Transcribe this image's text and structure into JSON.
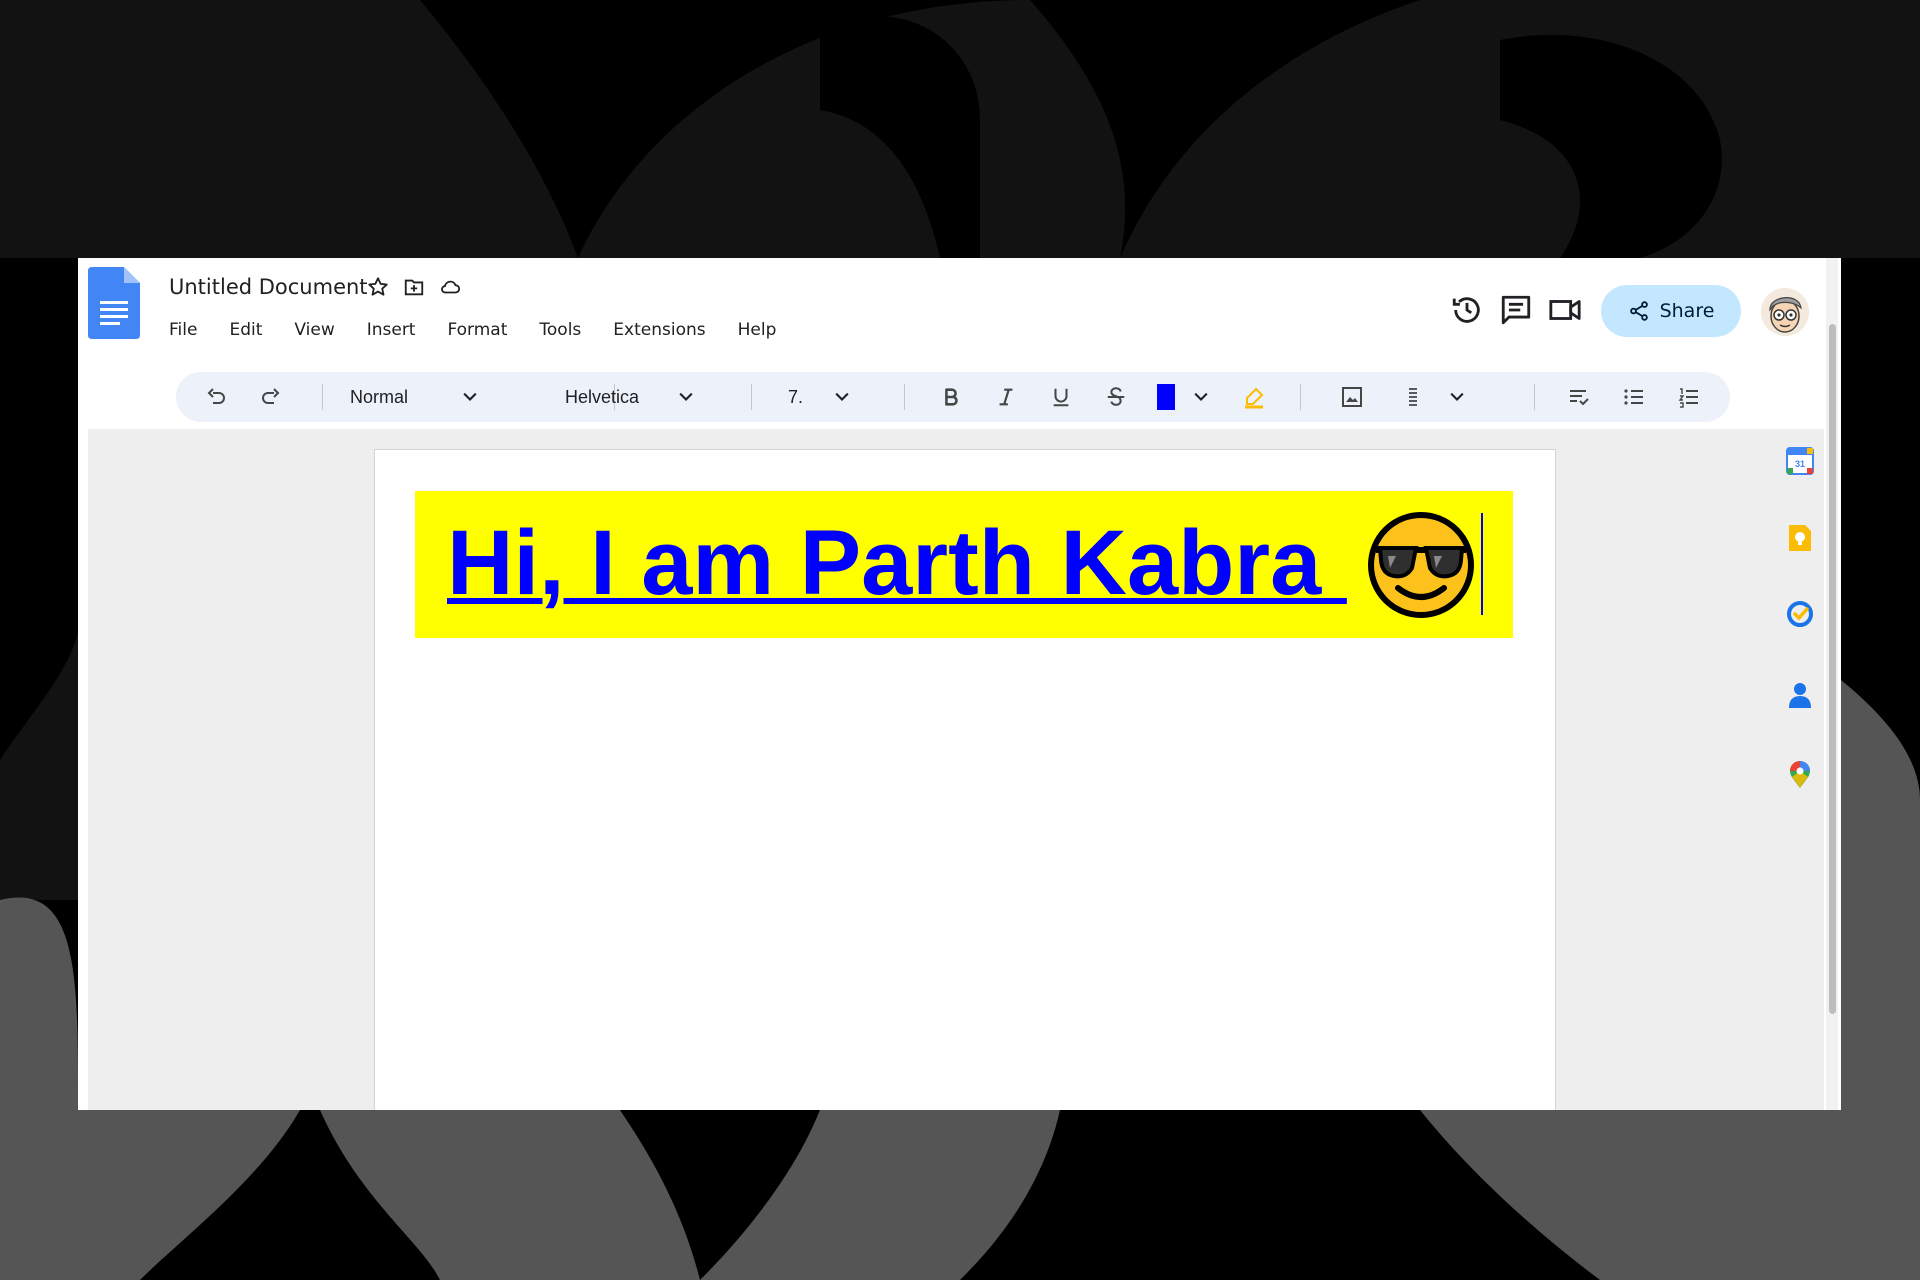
{
  "document": {
    "title": "Untitled Document",
    "heading": "Hi, I am Parth Kabra ",
    "heading_color": "#0000ff",
    "highlight_color": "#ffff00",
    "emoji": "smiling-face-with-sunglasses"
  },
  "menu": {
    "items": [
      "File",
      "Edit",
      "View",
      "Insert",
      "Format",
      "Tools",
      "Extensions",
      "Help"
    ]
  },
  "header": {
    "share_label": "Share",
    "icons": [
      "version-history-icon",
      "comments-icon",
      "meet-icon"
    ]
  },
  "toolbar": {
    "style": "Normal",
    "font": "Helvetica",
    "font_size": "7.",
    "text_color": "#0000ff",
    "highlight_color": "#fbbc04"
  },
  "side_panel": {
    "apps": [
      "calendar-icon",
      "keep-icon",
      "tasks-icon",
      "contacts-icon",
      "maps-icon"
    ]
  },
  "colors": {
    "share_bg": "#c2e7ff",
    "toolbar_bg": "#edf2fa",
    "docs_blue": "#4285f4"
  }
}
